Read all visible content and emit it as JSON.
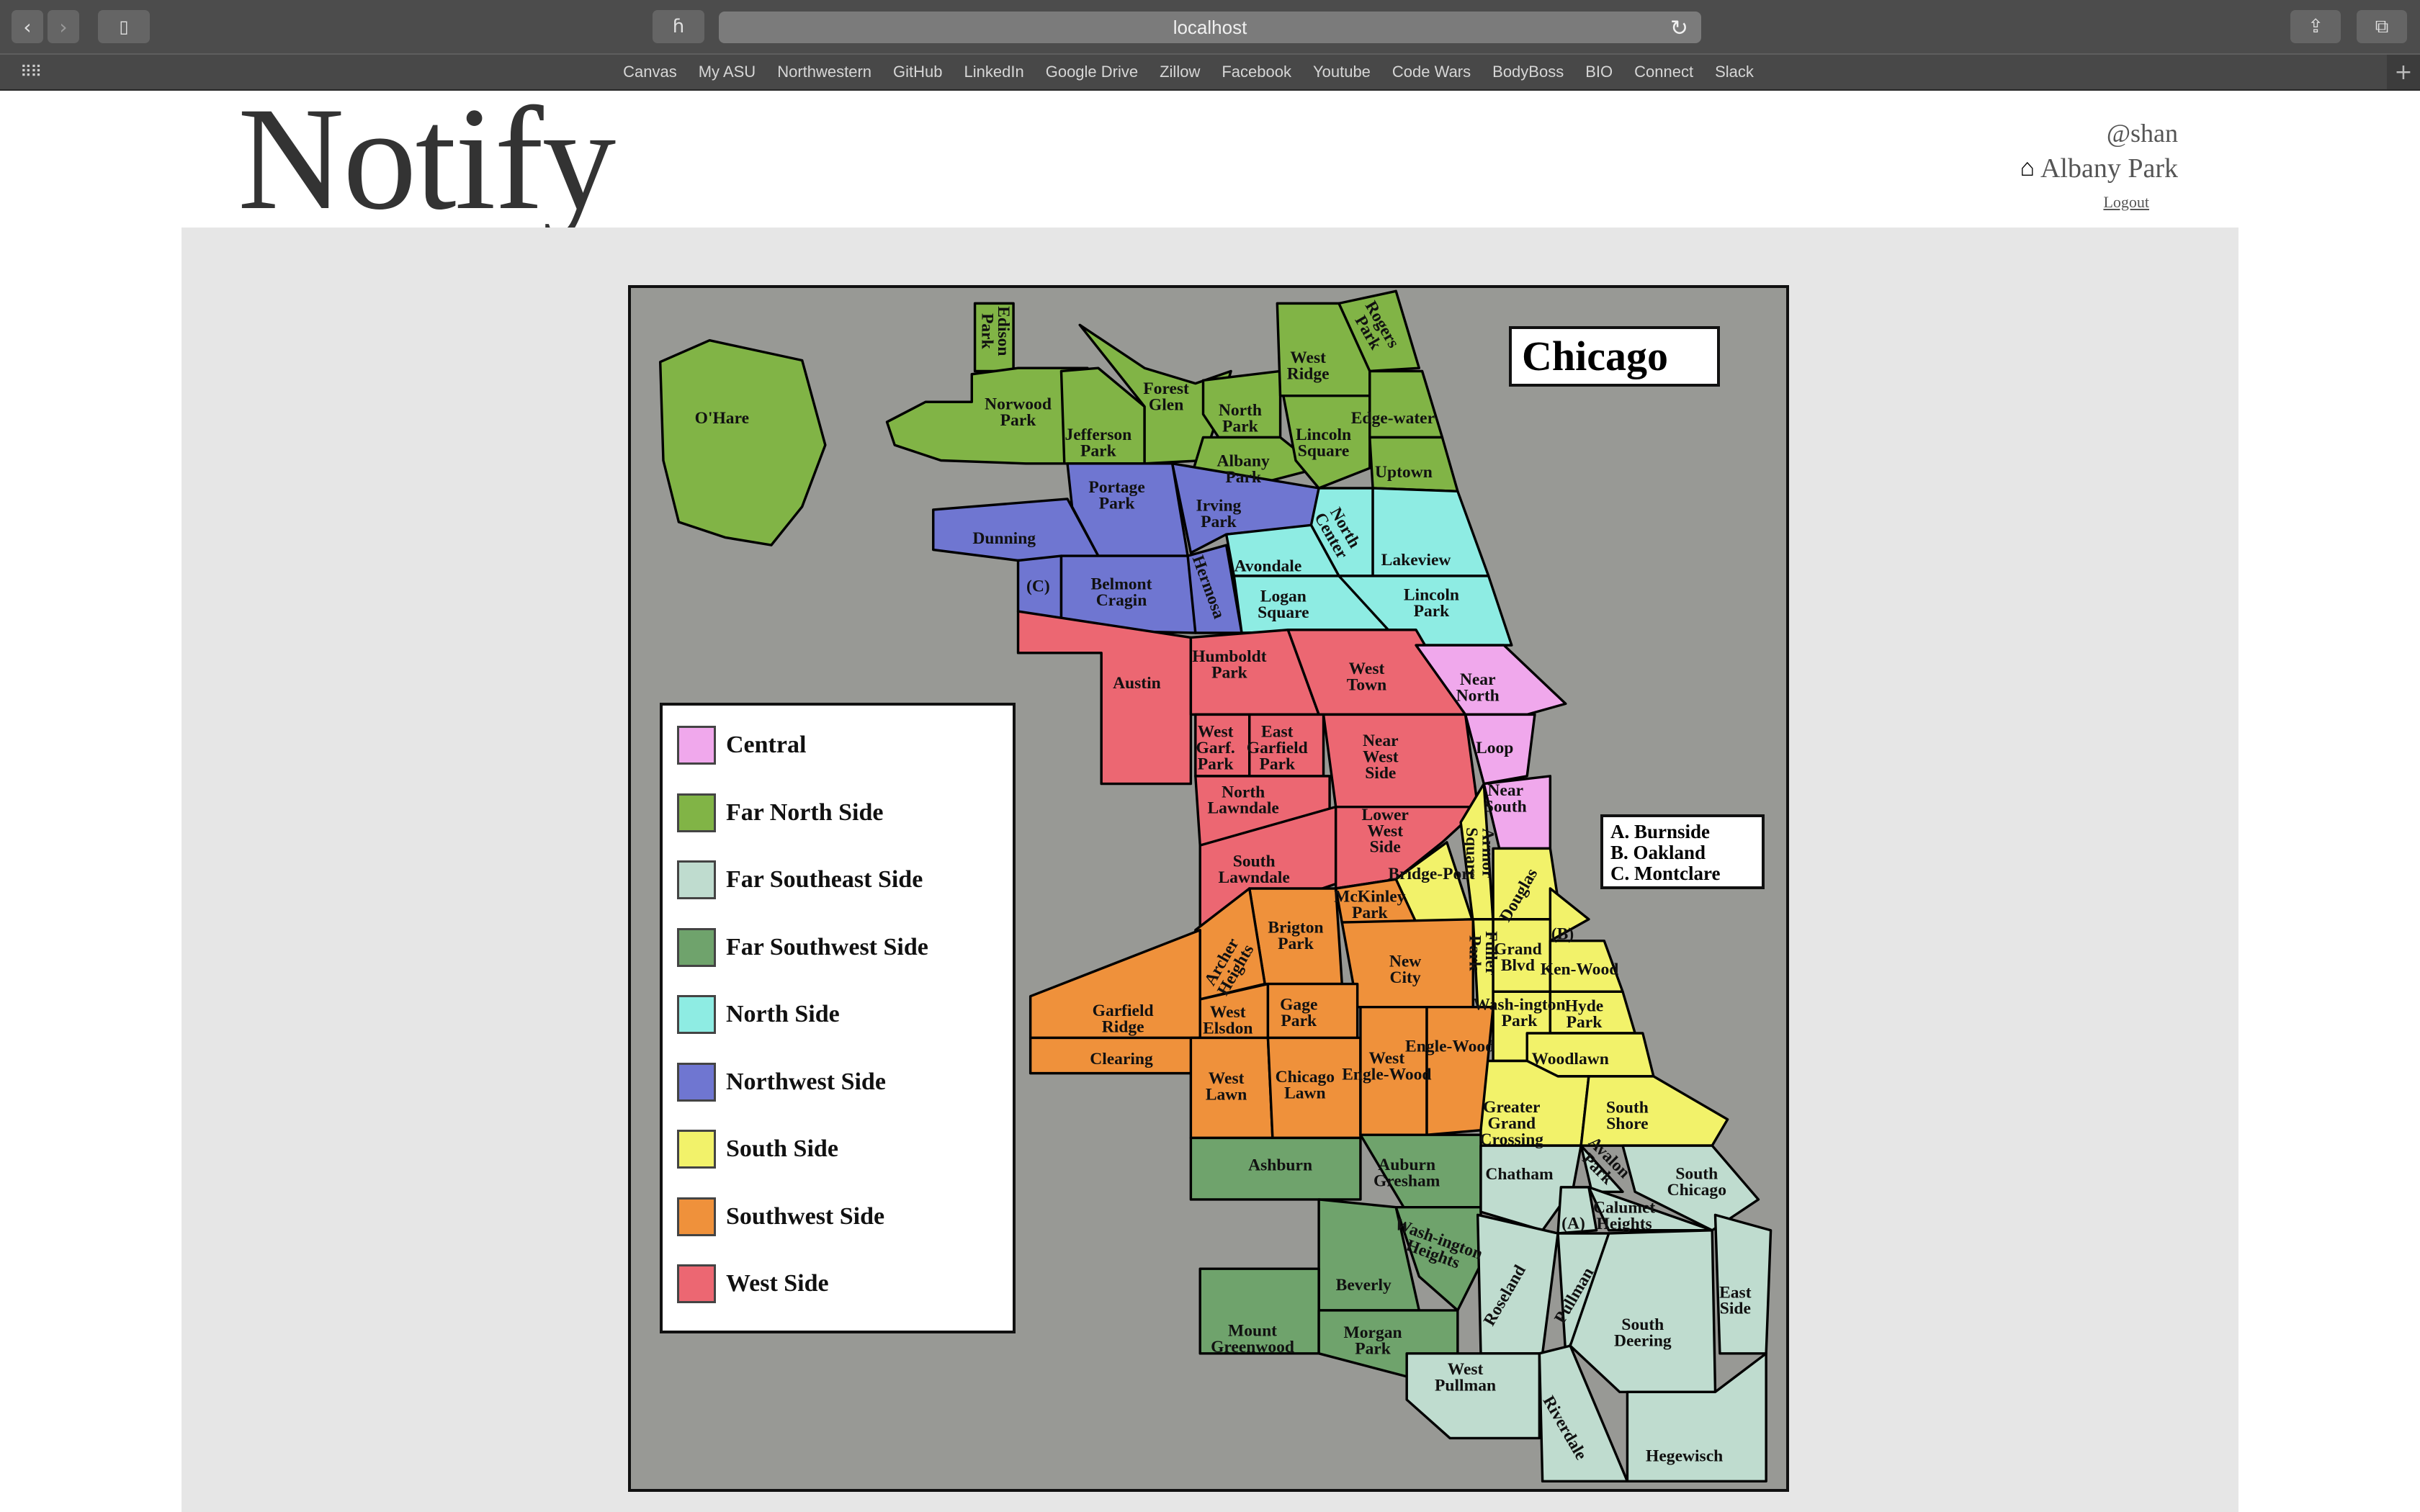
{
  "browser": {
    "url": "localhost",
    "bookmarks": [
      "Canvas",
      "My ASU",
      "Northwestern",
      "GitHub",
      "LinkedIn",
      "Google Drive",
      "Zillow",
      "Facebook",
      "Youtube",
      "Code Wars",
      "BodyBoss",
      "BIO",
      "Connect",
      "Slack"
    ],
    "icons": {
      "back": "chevron-left",
      "forward": "chevron-right",
      "sidebar": "sidebar",
      "extension": "h-glyph",
      "reload": "reload",
      "share": "share",
      "tabs": "tabs",
      "grid": "grid",
      "new_tab": "plus"
    }
  },
  "header": {
    "app_title": "Notify",
    "user_handle": "@shan",
    "home_icon": "house",
    "neighborhood": "Albany Park",
    "logout_label": "Logout"
  },
  "map": {
    "title": "Chicago",
    "background_color": "#989995",
    "key": [
      "A. Burnside",
      "B. Oakland",
      "C. Montclare"
    ],
    "regions": [
      {
        "name": "Central",
        "color": "#f0a8ec"
      },
      {
        "name": "Far North Side",
        "color": "#81b446"
      },
      {
        "name": "Far Southeast Side",
        "color": "#bfdccf"
      },
      {
        "name": "Far Southwest Side",
        "color": "#6fa36c"
      },
      {
        "name": "North Side",
        "color": "#8eece3"
      },
      {
        "name": "Northwest Side",
        "color": "#6f76d1"
      },
      {
        "name": "South Side",
        "color": "#f2f26a"
      },
      {
        "name": "Southwest Side",
        "color": "#ef913b"
      },
      {
        "name": "West Side",
        "color": "#ec6772"
      }
    ],
    "districts": [
      {
        "label": "O'Hare",
        "region": "Far North Side"
      },
      {
        "label": "Edison Park",
        "region": "Far North Side"
      },
      {
        "label": "Norwood Park",
        "region": "Far North Side"
      },
      {
        "label": "Jefferson Park",
        "region": "Far North Side"
      },
      {
        "label": "Forest Glen",
        "region": "Far North Side"
      },
      {
        "label": "North Park",
        "region": "Far North Side"
      },
      {
        "label": "Albany Park",
        "region": "Far North Side"
      },
      {
        "label": "West Ridge",
        "region": "Far North Side"
      },
      {
        "label": "Rogers Park",
        "region": "Far North Side"
      },
      {
        "label": "Lincoln Square",
        "region": "Far North Side"
      },
      {
        "label": "Edge-water",
        "region": "Far North Side"
      },
      {
        "label": "Uptown",
        "region": "Far North Side"
      },
      {
        "label": "Dunning",
        "region": "Northwest Side"
      },
      {
        "label": "Portage Park",
        "region": "Northwest Side"
      },
      {
        "label": "Irving Park",
        "region": "Northwest Side"
      },
      {
        "label": "(C)",
        "region": "Northwest Side"
      },
      {
        "label": "Belmont Cragin",
        "region": "Northwest Side"
      },
      {
        "label": "Hermosa",
        "region": "Northwest Side"
      },
      {
        "label": "North Center",
        "region": "North Side"
      },
      {
        "label": "Lakeview",
        "region": "North Side"
      },
      {
        "label": "Avondale",
        "region": "North Side"
      },
      {
        "label": "Logan Square",
        "region": "North Side"
      },
      {
        "label": "Lincoln Park",
        "region": "North Side"
      },
      {
        "label": "Austin",
        "region": "West Side"
      },
      {
        "label": "Humboldt Park",
        "region": "West Side"
      },
      {
        "label": "West Town",
        "region": "West Side"
      },
      {
        "label": "West Garf. Park",
        "region": "West Side"
      },
      {
        "label": "East Garfield Park",
        "region": "West Side"
      },
      {
        "label": "Near West Side",
        "region": "West Side"
      },
      {
        "label": "North Lawndale",
        "region": "West Side"
      },
      {
        "label": "South Lawndale",
        "region": "West Side"
      },
      {
        "label": "Lower West Side",
        "region": "West Side"
      },
      {
        "label": "Near North",
        "region": "Central"
      },
      {
        "label": "Loop",
        "region": "Central"
      },
      {
        "label": "Near South",
        "region": "Central"
      },
      {
        "label": "Armor Square",
        "region": "South Side"
      },
      {
        "label": "Bridge-Port",
        "region": "South Side"
      },
      {
        "label": "Douglas",
        "region": "South Side"
      },
      {
        "label": "(B)",
        "region": "South Side"
      },
      {
        "label": "Fuller Park",
        "region": "South Side"
      },
      {
        "label": "Grand Blvd",
        "region": "South Side"
      },
      {
        "label": "Ken-Wood",
        "region": "South Side"
      },
      {
        "label": "Wash-ington Park",
        "region": "South Side"
      },
      {
        "label": "Hyde Park",
        "region": "South Side"
      },
      {
        "label": "Woodlawn",
        "region": "South Side"
      },
      {
        "label": "Greater Grand Crossing",
        "region": "South Side"
      },
      {
        "label": "South Shore",
        "region": "South Side"
      },
      {
        "label": "McKinley Park",
        "region": "Southwest Side"
      },
      {
        "label": "Brigton Park",
        "region": "Southwest Side"
      },
      {
        "label": "Archer Heights",
        "region": "Southwest Side"
      },
      {
        "label": "New City",
        "region": "Southwest Side"
      },
      {
        "label": "Garfield Ridge",
        "region": "Southwest Side"
      },
      {
        "label": "West Elsdon",
        "region": "Southwest Side"
      },
      {
        "label": "Gage Park",
        "region": "Southwest Side"
      },
      {
        "label": "Clearing",
        "region": "Southwest Side"
      },
      {
        "label": "West Lawn",
        "region": "Southwest Side"
      },
      {
        "label": "Chicago Lawn",
        "region": "Southwest Side"
      },
      {
        "label": "West Engle-Wood",
        "region": "Southwest Side"
      },
      {
        "label": "Engle-Wood",
        "region": "Southwest Side"
      },
      {
        "label": "Ashburn",
        "region": "Far Southwest Side"
      },
      {
        "label": "Auburn Gresham",
        "region": "Far Southwest Side"
      },
      {
        "label": "Wash-ington Heights",
        "region": "Far Southwest Side"
      },
      {
        "label": "Beverly",
        "region": "Far Southwest Side"
      },
      {
        "label": "Mount Greenwood",
        "region": "Far Southwest Side"
      },
      {
        "label": "Morgan Park",
        "region": "Far Southwest Side"
      },
      {
        "label": "Chatham",
        "region": "Far Southeast Side"
      },
      {
        "label": "Avalon Park",
        "region": "Far Southeast Side"
      },
      {
        "label": "South Chicago",
        "region": "Far Southeast Side"
      },
      {
        "label": "(A)",
        "region": "Far Southeast Side"
      },
      {
        "label": "Calumet Heights",
        "region": "Far Southeast Side"
      },
      {
        "label": "Roseland",
        "region": "Far Southeast Side"
      },
      {
        "label": "Pullman",
        "region": "Far Southeast Side"
      },
      {
        "label": "South Deering",
        "region": "Far Southeast Side"
      },
      {
        "label": "East Side",
        "region": "Far Southeast Side"
      },
      {
        "label": "West Pullman",
        "region": "Far Southeast Side"
      },
      {
        "label": "Riverdale",
        "region": "Far Southeast Side"
      },
      {
        "label": "Hegewisch",
        "region": "Far Southeast Side"
      }
    ]
  }
}
